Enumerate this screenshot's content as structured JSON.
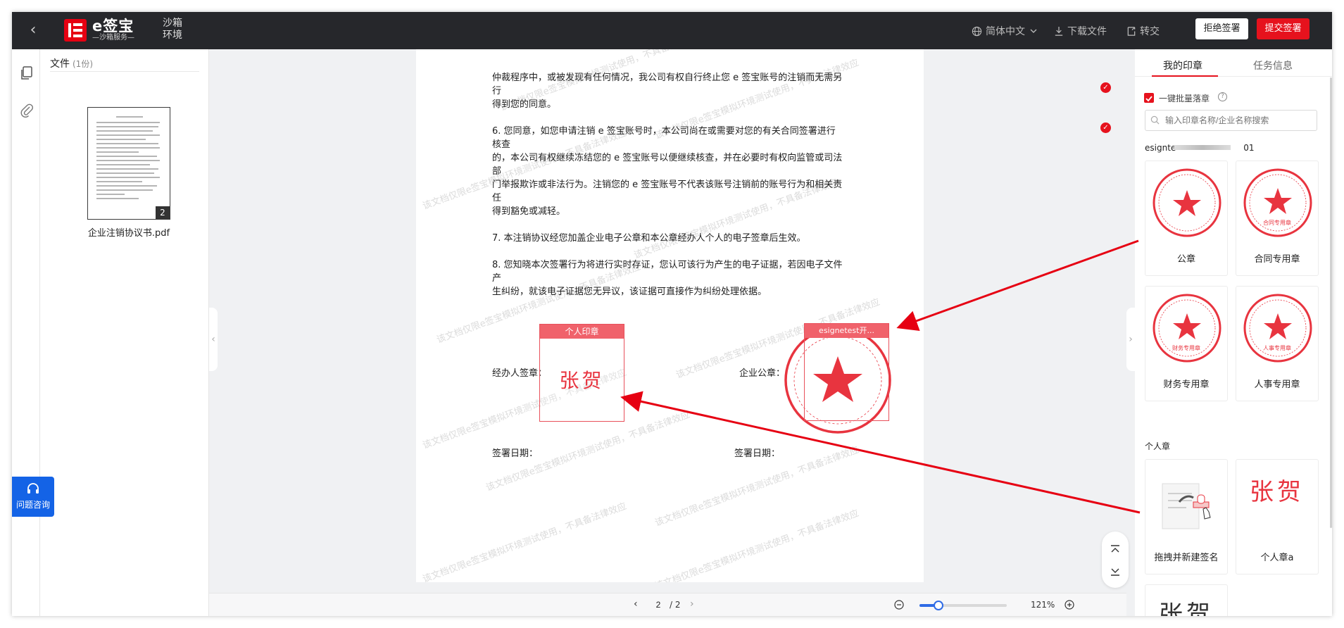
{
  "topbar": {
    "brand": "e签宝",
    "brand_sub": "—沙箱服务—",
    "env_label": "沙箱环境",
    "language": "简体中文",
    "download": "下载文件",
    "convert": "转交",
    "reject": "拒绝签署",
    "submit": "提交签署"
  },
  "files": {
    "title": "文件",
    "count": "(1份)",
    "thumb_page": "2",
    "file_name": "企业注销协议书.pdf"
  },
  "help": {
    "label": "问题咨询"
  },
  "document": {
    "paragraphs": [
      "仲裁程序中，或被发现有任何情况，我公司有权自行终止您 e 签宝账号的注销而无需另行",
      "得到您的同意。",
      "6. 您同意，如您申请注销 e 签宝账号时，本公司尚在或需要对您的有关合同签署进行核查",
      "的，本公司有权继续冻结您的 e 签宝账号以便继续核查，并在必要时有权向监管或司法部",
      "门举报欺诈或非法行为。注销您的 e 签宝账号不代表该账号注销前的账号行为和相关责任",
      "得到豁免或减轻。",
      "7. 本注销协议经您加盖企业电子公章和本公章经办人个人的电子签章后生效。",
      "8. 您知晓本次签署行为将进行实时存证，您认可该行为产生的电子证据，若因电子文件产",
      "生纠纷，就该电子证据您无异议，该证据可直接作为纠纷处理依据。"
    ],
    "handler_label": "经办人签章：",
    "company_label": "企业公章：",
    "date_label_left": "签署日期：",
    "date_label_right": "签署日期：",
    "personal_box_title": "个人印章",
    "personal_sig": "张贺",
    "company_box_title": "esignetest开...",
    "watermark": "该文档仅限e签宝模拟环境测试使用，不具备法律效应"
  },
  "pager": {
    "current": "2",
    "total": "/ 2",
    "zoom": "121%",
    "zoom_level": 0.22
  },
  "right_panel": {
    "tab_seals": "我的印章",
    "tab_task": "任务信息",
    "batch_label": "一键批量落章",
    "search_placeholder": "输入印章名称/企业名称搜索",
    "org_prefix": "esignte",
    "org_suffix": "01",
    "seals": [
      {
        "name": "公章",
        "inner": ""
      },
      {
        "name": "合同专用章",
        "inner": "合同专用章"
      },
      {
        "name": "财务专用章",
        "inner": "财务专用章"
      },
      {
        "name": "人事专用章",
        "inner": "人事专用章"
      }
    ],
    "personal_section": "个人章",
    "personal_seals": [
      {
        "name": "拖拽并新建签名"
      },
      {
        "name": "个人章a",
        "sig": "张贺"
      },
      {
        "sig": "张贺"
      }
    ]
  },
  "colors": {
    "accent": "#e6121d",
    "topbar": "#26272b",
    "seal_red": "#e8343f",
    "help_blue": "#1463e6"
  }
}
